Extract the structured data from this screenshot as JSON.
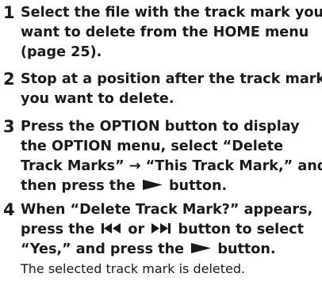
{
  "steps": [
    {
      "number": "1",
      "lines": [
        "Select the file with the track mark you",
        "want to delete from the HOME menu",
        "(page 25)."
      ]
    },
    {
      "number": "2",
      "lines": [
        "Stop at a position after the track mark",
        "you want to delete."
      ]
    },
    {
      "number": "3",
      "lines": [
        "Press the OPTION button to display",
        "the OPTION menu, select “Delete",
        "Track Marks” → “This Track Mark,” and"
      ],
      "line4_before": "then press the",
      "line4_after": "button."
    },
    {
      "number": "4",
      "line1": "When “Delete Track Mark?” appears,",
      "line2_before": "press the",
      "line2_middle": "or",
      "line2_after": "button to select",
      "line3_before": "“Yes,” and press the",
      "line3_after": "button.",
      "result": "The selected track mark is deleted."
    }
  ],
  "icons": {
    "play": "play-icon",
    "previous": "previous-track-icon",
    "next": "next-track-icon"
  }
}
